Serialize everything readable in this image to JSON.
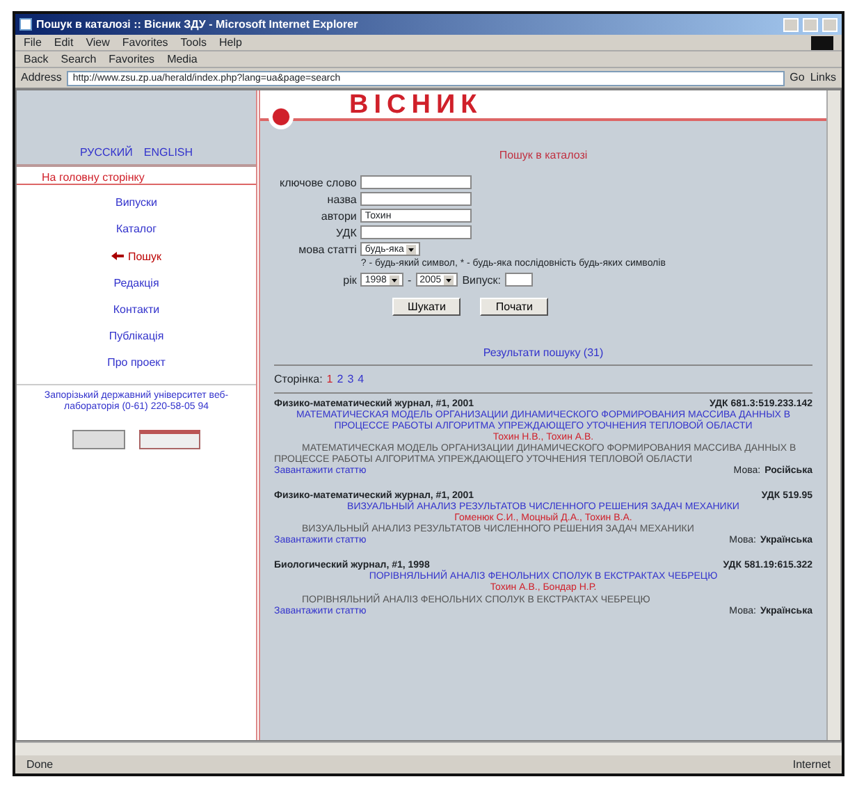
{
  "window": {
    "title": "Пошук в каталозі :: Вісник ЗДУ - Microsoft Internet Explorer"
  },
  "menu": [
    "File",
    "Edit",
    "View",
    "Favorites",
    "Tools",
    "Help"
  ],
  "toolbar": [
    "Back",
    "Search",
    "Favorites",
    "Media"
  ],
  "address": {
    "label": "Address",
    "value": "http://www.zsu.zp.ua/herald/index.php?lang=ua&page=search",
    "go": "Go",
    "links": "Links"
  },
  "site_title": "ВІСНИК",
  "languages": [
    {
      "label": "РУССКИЙ"
    },
    {
      "label": "ENGLISH"
    }
  ],
  "home_link": "На головну сторінку",
  "nav": [
    {
      "label": "Випуски",
      "selected": false
    },
    {
      "label": "Каталог",
      "selected": false
    },
    {
      "label": "Пошук",
      "selected": true
    },
    {
      "label": "Редакція",
      "selected": false
    },
    {
      "label": "Контакти",
      "selected": false
    },
    {
      "label": "Публікація",
      "selected": false
    },
    {
      "label": "Про проект",
      "selected": false
    }
  ],
  "footer_note": "Запорізький державний університет веб-лабораторія (0-61) 220-58-05 94",
  "search": {
    "heading": "Пошук в каталозі",
    "fields": [
      {
        "label": "ключове слово"
      },
      {
        "label": "назва"
      },
      {
        "label": "автори",
        "value": "Тохин"
      },
      {
        "label": "УДК"
      }
    ],
    "language": {
      "label": "мова статті",
      "value": "будь-яка"
    },
    "hint": "? - будь-який символ, * - будь-яка послідовність будь-яких символів",
    "year": {
      "label": "рік",
      "from": "1998",
      "to": "2005",
      "dash": "-",
      "issue_label": "Випуск:"
    },
    "buttons": [
      "Шукати",
      "Почати"
    ]
  },
  "results": {
    "heading": "Результати пошуку (31)",
    "pages_label": "Сторінка:",
    "pages": [
      {
        "label": "1",
        "selected": true
      },
      {
        "label": "2",
        "selected": false
      },
      {
        "label": "3",
        "selected": false
      },
      {
        "label": "4",
        "selected": false
      }
    ],
    "items": [
      {
        "journal": "Физико-математический журнал, #1, 2001",
        "udc": "УДК 681.3:519.233.142",
        "title": "МАТЕМАТИЧЕСКАЯ МОДЕЛЬ ОРГАНИЗАЦИИ ДИНАМИЧЕСКОГО ФОРМИРОВАНИЯ МАССИВА ДАННЫХ В ПРОЦЕССЕ РАБОТЫ АЛГОРИТМА УПРЕЖДАЮЩЕГО УТОЧНЕНИЯ ТЕПЛОВОЙ ОБЛАСТИ",
        "authors": "Тохин Н.В., Тохин А.В.",
        "abstract": "МАТЕМАТИЧЕСКАЯ МОДЕЛЬ ОРГАНИЗАЦИИ ДИНАМИЧЕСКОГО ФОРМИРОВАНИЯ МАССИВА ДАННЫХ В ПРОЦЕССЕ РАБОТЫ АЛГОРИТМА УПРЕЖДАЮЩЕГО УТОЧНЕНИЯ ТЕПЛОВОЙ ОБЛАСТИ",
        "download": "Завантажити статтю",
        "lang_label": "Мова:",
        "lang": "Російська"
      },
      {
        "journal": "Физико-математический журнал, #1, 2001",
        "udc": "УДК 519.95",
        "title": "ВИЗУАЛЬНЫЙ АНАЛИЗ РЕЗУЛЬТАТОВ ЧИСЛЕННОГО РЕШЕНИЯ ЗАДАЧ МЕХАНИКИ",
        "authors": "Гоменюк С.И., Моцный Д.А., Тохин В.А.",
        "abstract": "ВИЗУАЛЬНЫЙ АНАЛИЗ РЕЗУЛЬТАТОВ ЧИСЛЕННОГО РЕШЕНИЯ ЗАДАЧ МЕХАНИКИ",
        "download": "Завантажити статтю",
        "lang_label": "Мова:",
        "lang": "Українська"
      },
      {
        "journal": "Биологический журнал, #1, 1998",
        "udc": "УДК 581.19:615.322",
        "title": "ПОРІВНЯЛЬНИЙ АНАЛІЗ ФЕНОЛЬНИХ СПОЛУК В ЕКСТРАКТАХ ЧЕБРЕЦЮ",
        "authors": "Тохин А.В., Бондар Н.Р.",
        "abstract": "ПОРІВНЯЛЬНИЙ АНАЛІЗ ФЕНОЛЬНИХ СПОЛУК В ЕКСТРАКТАХ ЧЕБРЕЦЮ",
        "download": "Завантажити статтю",
        "lang_label": "Мова:",
        "lang": "Українська"
      }
    ]
  },
  "status_bar": {
    "left": "Done",
    "right": "Internet"
  }
}
